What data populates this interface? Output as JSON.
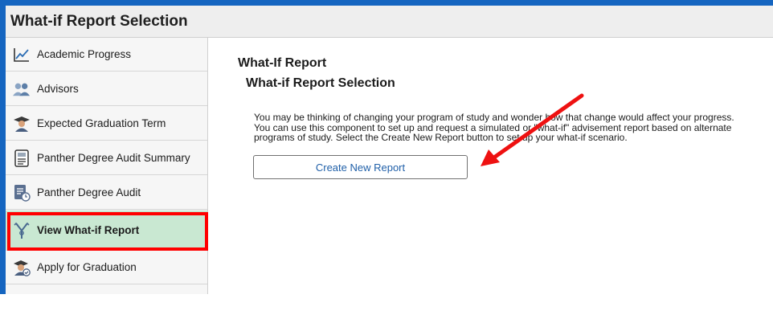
{
  "header": {
    "title": "What-if Report Selection"
  },
  "sidebar": {
    "items": [
      {
        "label": "Academic Progress",
        "icon": "chart-line-icon"
      },
      {
        "label": "Advisors",
        "icon": "people-icon"
      },
      {
        "label": "Expected Graduation Term",
        "icon": "graduate-icon"
      },
      {
        "label": "Panther Degree Audit Summary",
        "icon": "document-icon"
      },
      {
        "label": "Panther Degree Audit",
        "icon": "audit-document-icon"
      },
      {
        "label": "View What-if Report",
        "icon": "what-if-icon",
        "selected": true
      },
      {
        "label": "Apply for Graduation",
        "icon": "graduate-check-icon"
      }
    ]
  },
  "main": {
    "page_title": "What-If Report",
    "section_title": "What-if Report Selection",
    "description": "You may be thinking of changing your program of study and wonder how that change would affect your progress. You can use this component to set up and request a simulated or \"what-if\" advisement report based on alternate programs of study. Select the Create New Report button to set up your what-if scenario.",
    "create_button_label": "Create New Report"
  },
  "colors": {
    "frame_blue": "#1565c0",
    "selected_bg": "#c9e8d2",
    "highlight_red": "#ff0000",
    "button_text": "#1f5fa8"
  }
}
